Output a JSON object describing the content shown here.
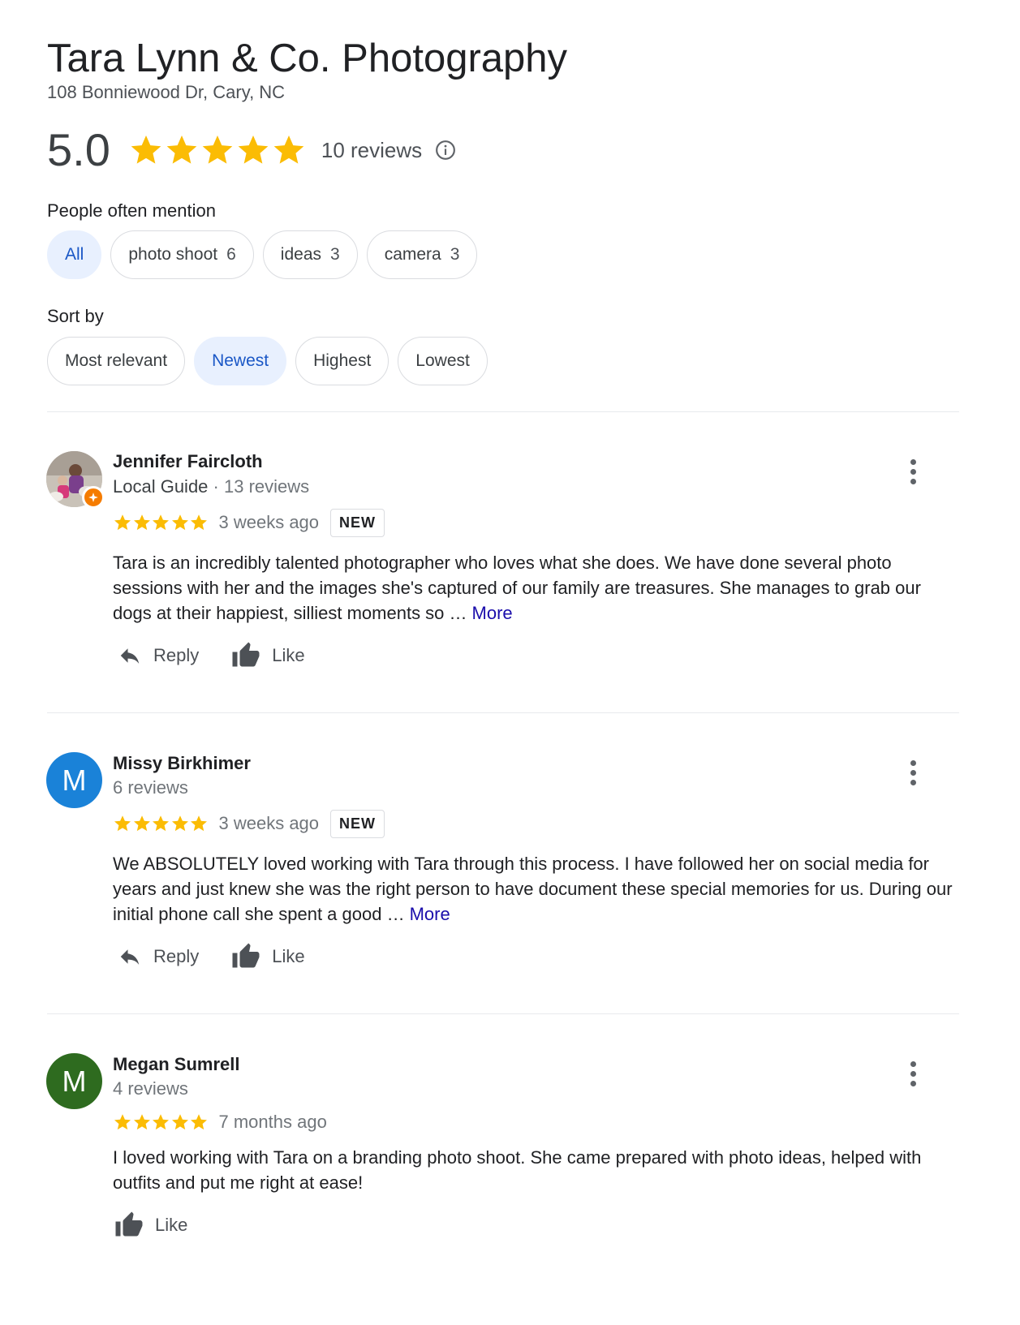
{
  "business": {
    "name": "Tara Lynn & Co. Photography",
    "address": "108 Bonniewood Dr, Cary, NC",
    "rating": "5.0",
    "rating_value": 5,
    "review_count": "10 reviews"
  },
  "mentions": {
    "label": "People often mention",
    "chips": [
      {
        "label": "All",
        "count": ""
      },
      {
        "label": "photo shoot",
        "count": "6"
      },
      {
        "label": "ideas",
        "count": "3"
      },
      {
        "label": "camera",
        "count": "3"
      }
    ]
  },
  "sort": {
    "label": "Sort by",
    "options": [
      "Most relevant",
      "Newest",
      "Highest",
      "Lowest"
    ],
    "selected": "Newest"
  },
  "reviews": [
    {
      "name": "Jennifer Faircloth",
      "guide_label": "Local Guide",
      "meta_sep": " · ",
      "reviews_count": "13 reviews",
      "stars": 5,
      "time": "3 weeks ago",
      "badge": "NEW",
      "text": "Tara is an incredibly talented photographer who loves what she does. We have done several photo sessions with her and the images she's captured of our family are treasures. She manages to grab our dogs at their happiest, silliest moments so …",
      "more": "More",
      "reply": "Reply",
      "like": "Like"
    },
    {
      "name": "Missy Birkhimer",
      "initial": "M",
      "avatar_color": "#1a82d8",
      "reviews_count": "6 reviews",
      "stars": 5,
      "time": "3 weeks ago",
      "badge": "NEW",
      "text": "We ABSOLUTELY loved working with Tara through this process. I have followed her on social media for years and just knew she was the right person to have document these special memories for us. During our initial phone call she spent a good …",
      "more": "More",
      "reply": "Reply",
      "like": "Like"
    },
    {
      "name": "Megan Sumrell",
      "initial": "M",
      "avatar_color": "#2e6b1f",
      "reviews_count": "4 reviews",
      "stars": 5,
      "time": "7 months ago",
      "text": "I loved working with Tara on a branding photo shoot.  She came prepared with photo ideas, helped with outfits and put me right at ease!",
      "like": "Like"
    }
  ],
  "colors": {
    "star": "#fbbc04",
    "accent": "#1a57c6",
    "link": "#1a0dab"
  }
}
